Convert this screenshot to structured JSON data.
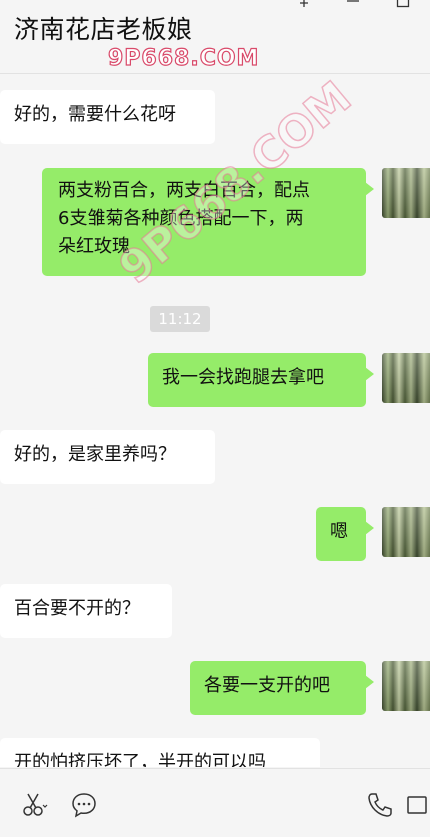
{
  "header": {
    "title": "济南花店老板娘",
    "watermark": "9P668.COM"
  },
  "chat": {
    "messages": [
      {
        "side": "in",
        "text": "好的，需要什么花呀"
      },
      {
        "side": "out",
        "lines": [
          "两支粉百合，两支白百合，配点",
          "6支雏菊各种颜色搭配一下，两",
          "朵红玫瑰"
        ]
      },
      {
        "side": "out",
        "text": "我一会找跑腿去拿吧"
      },
      {
        "side": "in",
        "text": "好的，是家里养吗？"
      },
      {
        "side": "out",
        "text": "嗯"
      },
      {
        "side": "in",
        "text": "百合要不开的？"
      },
      {
        "side": "out",
        "text": "各要一支开的吧"
      },
      {
        "side": "in",
        "text": "开的怕挤压坏了，半开的可以吗"
      }
    ],
    "timestamp": "11:12",
    "watermark": "9P668.COM"
  },
  "toolbar": {
    "icons": [
      "scissors-icon",
      "chat-bubble-icon",
      "phone-icon",
      "video-icon"
    ]
  }
}
